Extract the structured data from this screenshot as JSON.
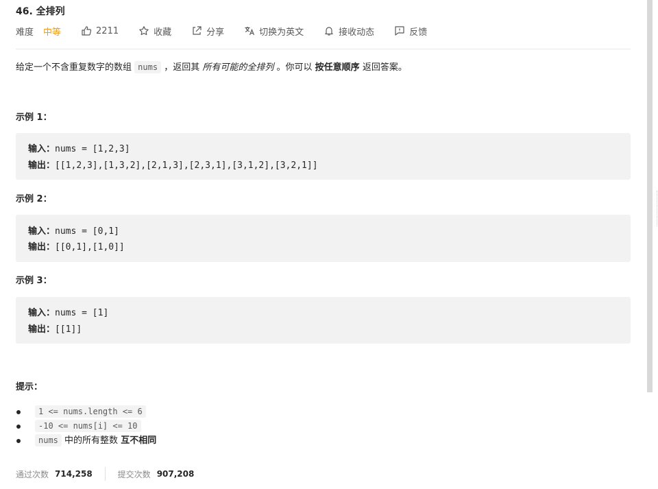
{
  "problem": {
    "title": "46. 全排列"
  },
  "meta": {
    "difficulty_label": "难度",
    "difficulty_value": "中等",
    "likes": "2211",
    "favorite": "收藏",
    "share": "分享",
    "switch_lang": "切换为英文",
    "subscribe": "接收动态",
    "feedback": "反馈"
  },
  "description": {
    "p1": "给定一个不含重复数字的数组",
    "code": "nums",
    "p2": "，返回其",
    "em": "所有可能的全排列",
    "p3": "。你可以",
    "strong": "按任意顺序",
    "p4": "返回答案。"
  },
  "examples": [
    {
      "title": "示例 1：",
      "input_label": "输入：",
      "input": "nums = [1,2,3]",
      "output_label": "输出：",
      "output": "[[1,2,3],[1,3,2],[2,1,3],[2,3,1],[3,1,2],[3,2,1]]"
    },
    {
      "title": "示例 2：",
      "input_label": "输入：",
      "input": "nums = [0,1]",
      "output_label": "输出：",
      "output": "[[0,1],[1,0]]"
    },
    {
      "title": "示例 3：",
      "input_label": "输入：",
      "input": "nums = [1]",
      "output_label": "输出：",
      "output": "[[1]]"
    }
  ],
  "hints": {
    "title": "提示：",
    "items": [
      "1 <= nums.length <= 6",
      "-10 <= nums[i] <= 10"
    ],
    "third_code": "nums",
    "third_text": "中的所有整数",
    "third_strong": "互不相同"
  },
  "stats": {
    "accepted_label": "通过次数",
    "accepted_value": "714,258",
    "submitted_label": "提交次数",
    "submitted_value": "907,208"
  }
}
